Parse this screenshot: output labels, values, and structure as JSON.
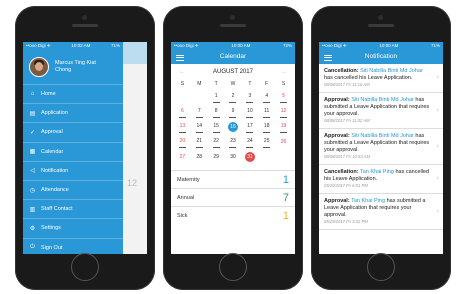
{
  "colors": {
    "accent": "#2a97d6",
    "weekend": "#e24b4b",
    "maternity": "#2a97d6",
    "annual": "#2e9e6a",
    "sick": "#f0b32a"
  },
  "phone1": {
    "status": {
      "carrier": "••ooo Digi ✈",
      "time": "10:02 AM",
      "battery": "71%"
    },
    "profile_name_1": "Marcus Ting Kiat",
    "profile_name_2": "Chong",
    "menu": [
      {
        "icon": "home-icon",
        "glyph": "⌂",
        "label": "Home"
      },
      {
        "icon": "document-icon",
        "glyph": "▤",
        "label": "Application"
      },
      {
        "icon": "check-icon",
        "glyph": "✓",
        "label": "Approval"
      },
      {
        "icon": "calendar-icon",
        "glyph": "▦",
        "label": "Calendar"
      },
      {
        "icon": "megaphone-icon",
        "glyph": "◁",
        "label": "Notification"
      },
      {
        "icon": "clock-icon",
        "glyph": "◷",
        "label": "Attendance"
      },
      {
        "icon": "contacts-icon",
        "glyph": "▥",
        "label": "Staff Contact"
      },
      {
        "icon": "gear-icon",
        "glyph": "⚙",
        "label": "Settings"
      },
      {
        "icon": "power-icon",
        "glyph": "⏻",
        "label": "Sign Out"
      }
    ],
    "behind_number": "12"
  },
  "phone2": {
    "status": {
      "carrier": "••ooo Digi ✈",
      "time": "10:00 AM",
      "battery": "72%"
    },
    "title": "Calendar",
    "month": "AUGUST 2017",
    "days": [
      "S",
      "M",
      "T",
      "W",
      "T",
      "F",
      "S"
    ],
    "leave": [
      {
        "label": "Maternity",
        "value": "1"
      },
      {
        "label": "Annual",
        "value": "7"
      },
      {
        "label": "Sick",
        "value": "1"
      }
    ]
  },
  "phone3": {
    "status": {
      "carrier": "••ooo Digi ✈",
      "time": "10:00 AM",
      "battery": "71%"
    },
    "title": "Notification",
    "items": [
      {
        "kind": "Cancellation:",
        "name": "Siti Nabilla Binti Md Johar",
        "text": "has cancelled his Leave Application.",
        "date": "08/08/2017 Fri 11:16 AM"
      },
      {
        "kind": "Approval:",
        "name": "Siti Nabilla Binti Md Johar",
        "text": "has submitted a Leave Application that requires your approval.",
        "date": "08/08/2017 Fri 11:02 AM"
      },
      {
        "kind": "Approval:",
        "name": "Siti Nabilla Binti Md Johar",
        "text": "has submitted a Leave Application that requires your approval.",
        "date": "08/08/2017 Fri 10:53 AM"
      },
      {
        "kind": "Cancellation:",
        "name": "Tan Khai Ping",
        "text": "has cancelled his Leave Application.",
        "date": "05/29/2017 Fri 6:01 PM"
      },
      {
        "kind": "Approval:",
        "name": "Tan Khai Ping",
        "text": "has submitted a Leave Application that requires your approval.",
        "date": "05/29/2017 Fri 3:32 PM"
      }
    ]
  }
}
